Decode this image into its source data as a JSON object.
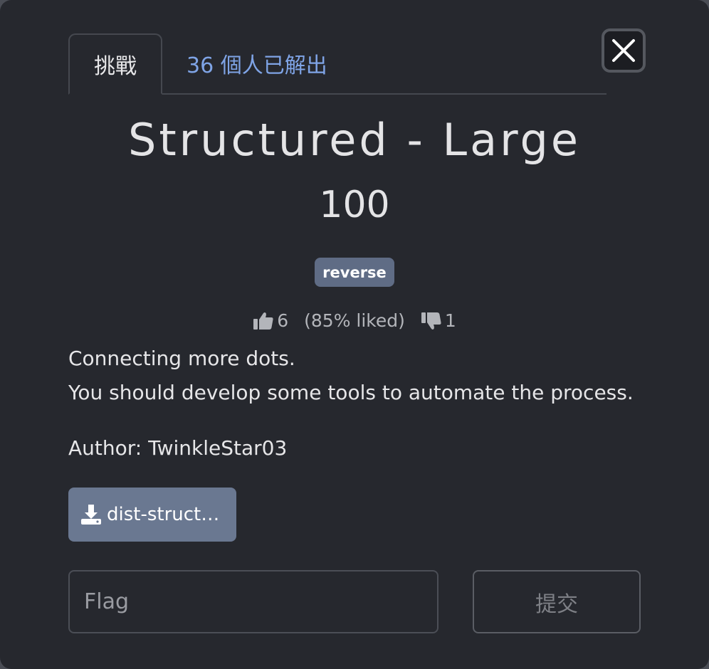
{
  "tabs": {
    "challenge_label": "挑戰",
    "solves_label": "36 個人已解出"
  },
  "challenge": {
    "title": "Structured - Large",
    "points": "100",
    "tag": "reverse",
    "likes": "6",
    "liked_percent": "(85% liked)",
    "dislikes": "1",
    "description_lines": [
      "Connecting more dots.",
      "You should develop some tools to automate the process."
    ],
    "author": "Author: TwinkleStar03",
    "file_label": "dist-struct…"
  },
  "submit": {
    "flag_placeholder": "Flag",
    "button_label": "提交"
  },
  "icons": {
    "close": "close-icon",
    "like": "thumbs-up-icon",
    "dislike": "thumbs-down-icon",
    "download": "download-icon"
  },
  "colors": {
    "background": "#26282e",
    "tag": "#5f6c85",
    "file_button": "#6a7891",
    "solves_link": "#7fa4e6"
  }
}
